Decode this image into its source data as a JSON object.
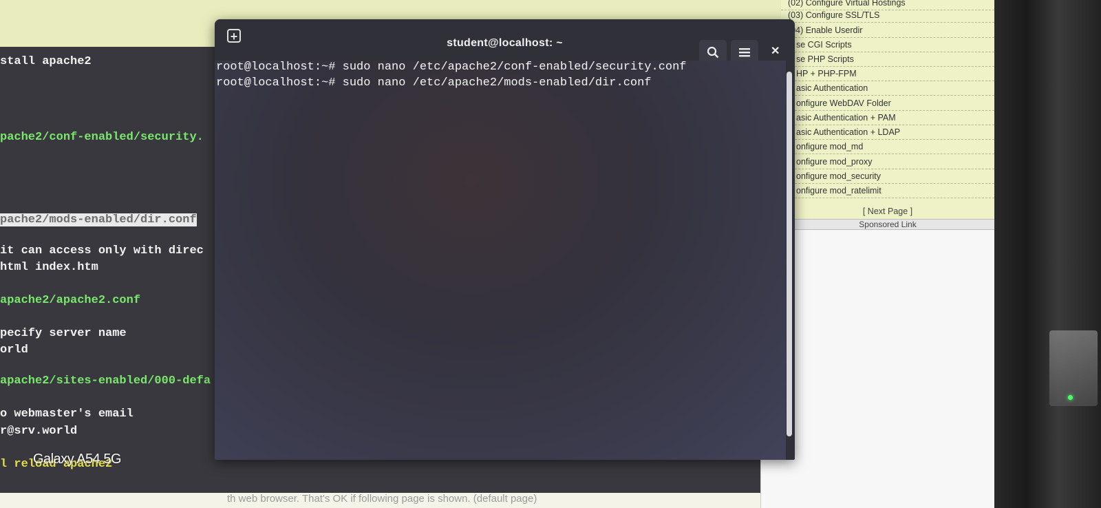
{
  "sidebar": {
    "items": [
      "(02) Configure Virtual Hostings",
      "(03) Configure SSL/TLS",
      "(04) Enable Userdir",
      "se CGI Scripts",
      "se PHP Scripts",
      "HP + PHP-FPM",
      "asic Authentication",
      "onfigure WebDAV Folder",
      "asic Authentication + PAM",
      "asic Authentication + LDAP",
      "onfigure mod_md",
      "onfigure mod_proxy",
      "onfigure mod_security",
      "onfigure mod_ratelimit"
    ],
    "next_page": "[ Next Page ]",
    "sponsored": "Sponsored Link"
  },
  "code_lines": {
    "l1": "stall apache2",
    "l2": "pache2/conf-enabled/security.",
    "l3": "pache2/mods-enabled/dir.conf",
    "l4": "it can access only with direc",
    "l5": "html index.htm",
    "l6": "apache2/apache2.conf",
    "l7": "pecify server name",
    "l8": "orld",
    "l9": "apache2/sites-enabled/000-defa",
    "l10": "o webmaster's email",
    "l11": "r@srv.world",
    "l12": "l reload apache2"
  },
  "bottom_text": "th web browser. That's OK if following page is shown. (default page)",
  "watermark": "Galaxy A54 5G",
  "terminal": {
    "title": "student@localhost: ~",
    "lines": [
      "root@localhost:~# sudo nano /etc/apache2/conf-enabled/security.conf",
      "root@localhost:~# sudo nano /etc/apache2/mods-enabled/dir.conf"
    ]
  },
  "colors": {
    "page_bg": "#f4f5e8",
    "sidebar_bg": "#eef2c6",
    "codebox_bg": "#38383e",
    "code_green": "#79e86b",
    "terminal_bg": "#303039"
  },
  "icons": {
    "new_tab": "new-tab-icon",
    "search": "search-icon",
    "menu": "hamburger-menu-icon",
    "close": "close-icon"
  }
}
